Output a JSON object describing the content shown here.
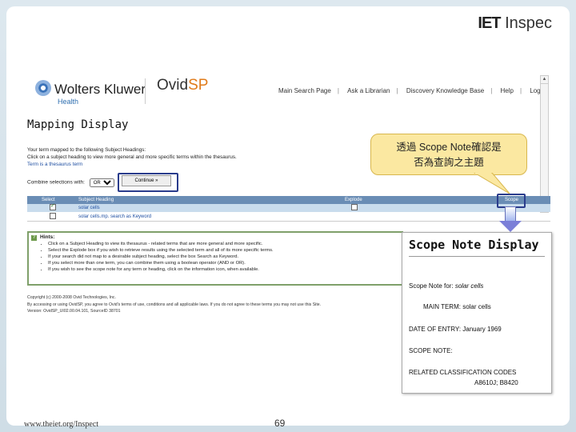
{
  "header": {
    "brand_bold": "IET",
    "brand_rest": " Inspec"
  },
  "ovid": {
    "wk_name": "Wolters Kluwer",
    "wk_sub": "Health",
    "ovid_prefix": "Ovid",
    "ovid_suffix": "SP",
    "nav": [
      "Main Search Page",
      "Ask a Librarian",
      "Discovery Knowledge Base",
      "Help",
      "Logoff"
    ]
  },
  "mapping": {
    "title": "Mapping Display",
    "intro": [
      "Your term mapped to the following Subject Headings:",
      "Click on a subject heading to view more general and more specific terms within the thesaurus.",
      "Term is a thesaurus term"
    ],
    "combine_label": "Combine selections with:",
    "combine_value": "OR",
    "continue_label": "Continue »",
    "columns": {
      "select": "Select",
      "subject": "Subject Heading",
      "explode": "Explode",
      "scope": "Scope"
    },
    "rows": [
      {
        "subject": "solar cells",
        "checked": true
      },
      {
        "subject": "solar cells.mp. search as Keyword",
        "checked": false
      }
    ]
  },
  "hints": {
    "title": "Hints:",
    "items": [
      "Click on a Subject Heading to view its thesaurus - related terms that are more general and more specific.",
      "Select the Explode box if you wish to retrieve results using the selected term and all of its more specific terms.",
      "If your search did not map to a desirable subject heading, select the box Search as Keyword.",
      "If you select more than one term, you can combine them using a boolean operator (AND or OR).",
      "If you wish to see the scope note for any term or heading, click on the information icon, when available."
    ]
  },
  "footer": {
    "lines": [
      "Copyright (c) 2000-2008 Ovid Technologies, Inc.",
      "By accessing or using OvidSP, you agree to Ovid's terms of use, conditions and all applicable laws. If you do not agree to these terms you may not use this Site.",
      "Version: OvidSP_UI02.00.04.101, SourceID 38701"
    ]
  },
  "callout": {
    "line1": "透過 Scope Note確認是",
    "line2": "否為查詢之主題"
  },
  "scope_note": {
    "title": "Scope Note Display",
    "scope_for_label": "Scope Note for:",
    "scope_for_term": "solar cells",
    "main_term": "MAIN TERM: solar cells",
    "date_of_entry": "DATE OF ENTRY: January 1969",
    "scope_note_label": "SCOPE NOTE:",
    "related_codes": "RELATED CLASSIFICATION CODES",
    "codes_value": "A8610J; B8420"
  },
  "slide": {
    "url": "www.theiet.org/Inspect",
    "page": "69"
  },
  "colors": {
    "table_header": "#6a8db5",
    "row_highlight": "#c9dced",
    "callout_bg": "#fbe8a1",
    "hint_border": "#7fa06a"
  }
}
